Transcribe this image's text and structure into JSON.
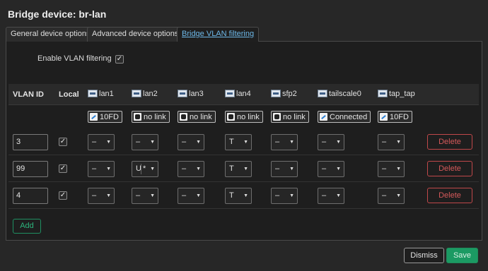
{
  "dialog": {
    "title": "Bridge device: br-lan"
  },
  "tabs": [
    {
      "label": "General device options",
      "active": false
    },
    {
      "label": "Advanced device options",
      "active": false
    },
    {
      "label": "Bridge VLAN filtering",
      "active": true
    }
  ],
  "vlan_filtering": {
    "label": "Enable VLAN filtering",
    "checked": true
  },
  "table": {
    "headers": {
      "vlan_id": "VLAN ID",
      "local": "Local"
    },
    "ports": [
      {
        "name": "lan1",
        "icon": "ethernet-icon",
        "status": "10FD",
        "status_icon": "link-up-icon"
      },
      {
        "name": "lan2",
        "icon": "ethernet-icon",
        "status": "no link",
        "status_icon": "no-link-icon"
      },
      {
        "name": "lan3",
        "icon": "ethernet-icon",
        "status": "no link",
        "status_icon": "no-link-icon"
      },
      {
        "name": "lan4",
        "icon": "ethernet-icon",
        "status": "no link",
        "status_icon": "no-link-icon"
      },
      {
        "name": "sfp2",
        "icon": "ethernet-icon",
        "status": "no link",
        "status_icon": "no-link-icon"
      },
      {
        "name": "tailscale0",
        "icon": "tunnel-icon",
        "status": "Connected",
        "status_icon": "link-up-icon"
      },
      {
        "name": "tap_tap",
        "icon": "tunnel-icon",
        "status": "10FD",
        "status_icon": "link-up-icon"
      }
    ],
    "rows": [
      {
        "vlan_id": "3",
        "local": true,
        "ports": [
          "–",
          "–",
          "–",
          "T",
          "–",
          "–",
          "–"
        ],
        "delete_label": "Delete"
      },
      {
        "vlan_id": "99",
        "local": true,
        "ports": [
          "–",
          "U",
          "–",
          "T",
          "–",
          "–",
          "–"
        ],
        "lan2_primary": "*",
        "delete_label": "Delete"
      },
      {
        "vlan_id": "4",
        "local": true,
        "ports": [
          "–",
          "–",
          "–",
          "T",
          "–",
          "–",
          "–"
        ],
        "delete_label": "Delete"
      }
    ],
    "add_label": "Add"
  },
  "footer": {
    "dismiss_label": "Dismiss",
    "save_label": "Save"
  },
  "colors": {
    "background": "#272727",
    "link_tab": "#6db8e8",
    "delete": "#d5595a",
    "save": "#1b9a63",
    "add": "#2db37c"
  }
}
